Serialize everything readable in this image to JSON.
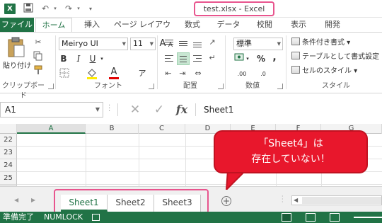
{
  "app": {
    "title": "test.xlsx - Excel",
    "icon_letter": "X",
    "accent_color": "#217346",
    "highlight_color": "#e8558e"
  },
  "quick_access": [
    "save-icon",
    "undo-icon",
    "redo-icon",
    "customize-icon"
  ],
  "ribbon": {
    "tabs": [
      "ファイル",
      "ホーム",
      "挿入",
      "ページ レイアウト",
      "数式",
      "データ",
      "校閲",
      "表示",
      "開発"
    ],
    "groups": {
      "clipboard": {
        "label": "クリップボード",
        "paste_label": "貼り付け"
      },
      "font": {
        "label": "フォント",
        "font_name": "Meiryo UI",
        "font_size": "11",
        "grow_font": "A",
        "shrink_font": "A",
        "bold": "B",
        "italic": "I",
        "underline": "U",
        "font_color": "A",
        "phonetic": "ア"
      },
      "alignment": {
        "label": "配置"
      },
      "number": {
        "label": "数値",
        "format": "標準",
        "percent": "%",
        "comma": ",",
        "inc_decimal": ".00",
        "dec_decimal": ".0"
      },
      "styles": {
        "label": "スタイル",
        "conditional": "条件付き書式 ▾",
        "table_format": "テーブルとして書式設定 ▾",
        "cell_styles": "セルのスタイル ▾"
      }
    }
  },
  "formula_bar": {
    "name_box": "A1",
    "cancel": "✕",
    "enter": "✓",
    "fx": "fx",
    "content": "Sheet1"
  },
  "grid": {
    "columns": [
      "A",
      "B",
      "C",
      "D",
      "E",
      "F",
      "G"
    ],
    "selected_column": "A",
    "rows": [
      "22",
      "23",
      "24",
      "25"
    ]
  },
  "sheets": {
    "tabs": [
      "Sheet1",
      "Sheet2",
      "Sheet3"
    ],
    "active": "Sheet1",
    "add": "+"
  },
  "status": {
    "mode": "準備完了",
    "numlock": "NUMLOCK"
  },
  "callout": {
    "line1": "「Sheet4」は",
    "line2": "存在していない！",
    "color": "#e8172c"
  }
}
